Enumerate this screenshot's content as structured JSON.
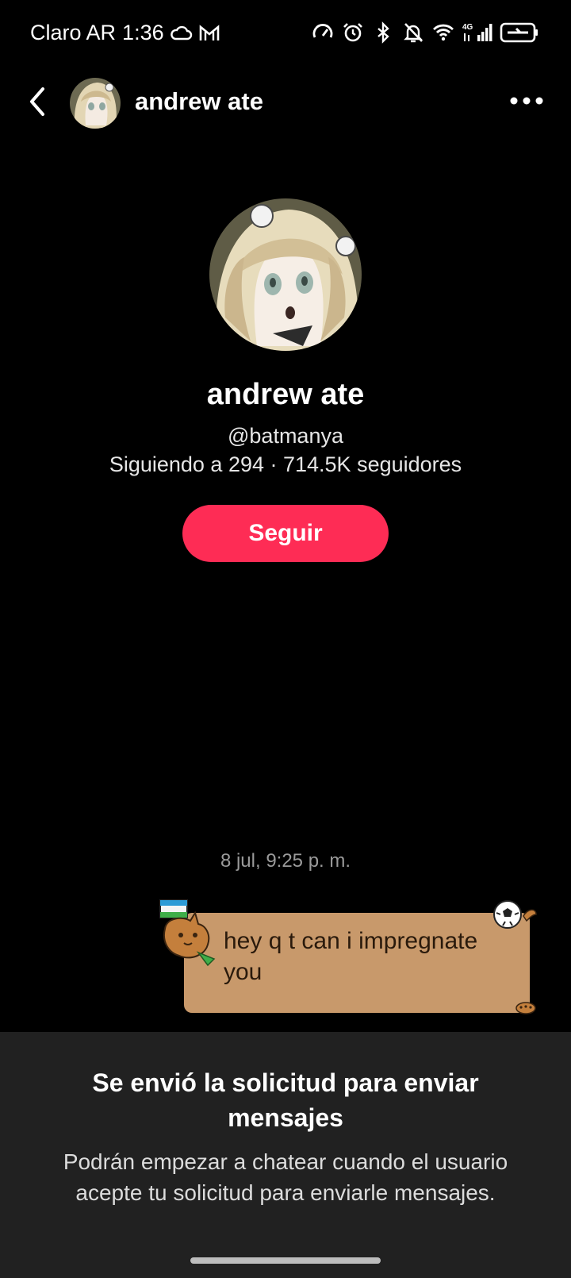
{
  "status_bar": {
    "carrier": "Claro AR",
    "time": "1:36",
    "network": "4G"
  },
  "header": {
    "name": "andrew ate"
  },
  "profile": {
    "name": "andrew ate",
    "handle": "@batmanya",
    "stats": "Siguiendo a 294 · 714.5K seguidores",
    "follow_label": "Seguir"
  },
  "chat": {
    "timestamp": "8 jul, 9:25 p. m.",
    "message": "hey q t can i impregnate you"
  },
  "sheet": {
    "title": "Se envió la solicitud para enviar mensajes",
    "body": "Podrán empezar a chatear cuando el usuario acepte tu solicitud para enviarle mensajes."
  },
  "colors": {
    "accent": "#fe2c55",
    "bubble": "#c8996b",
    "sheet_bg": "#212121"
  },
  "icons": [
    "cloud-icon",
    "gmail-icon",
    "speedometer-icon",
    "alarm-icon",
    "bluetooth-icon",
    "mute-icon",
    "wifi-icon",
    "signal-icon",
    "battery-icon",
    "back-icon",
    "more-icon"
  ]
}
